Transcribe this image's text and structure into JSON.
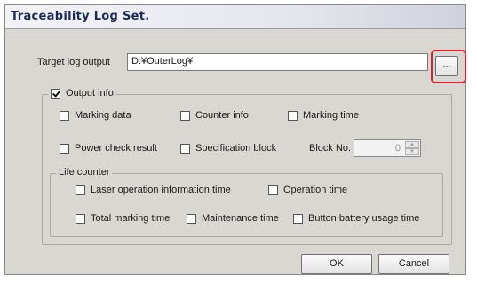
{
  "window": {
    "title": "Traceability Log Set."
  },
  "target_log": {
    "label": "Target log output",
    "value": "D:¥OuterLog¥",
    "browse_label": "..."
  },
  "output_info": {
    "label": "Output info",
    "checked": true,
    "options": [
      {
        "label": "Marking data",
        "checked": false
      },
      {
        "label": "Counter info",
        "checked": false
      },
      {
        "label": "Marking time",
        "checked": false
      },
      {
        "label": "Power check result",
        "checked": false
      },
      {
        "label": "Specification block",
        "checked": false
      }
    ],
    "block_no": {
      "label": "Block No.",
      "value": "0",
      "enabled": false
    }
  },
  "life_counter": {
    "label": "Life counter",
    "options": [
      {
        "label": "Laser operation information time",
        "checked": false
      },
      {
        "label": "Operation time",
        "checked": false
      },
      {
        "label": "Total marking time",
        "checked": false
      },
      {
        "label": "Maintenance time",
        "checked": false
      },
      {
        "label": "Button battery usage time",
        "checked": false
      }
    ]
  },
  "buttons": {
    "ok": "OK",
    "cancel": "Cancel"
  },
  "colors": {
    "highlight": "#d8202f",
    "title_text": "#1a2a5a",
    "dialog_bg": "#d9d7d2"
  }
}
